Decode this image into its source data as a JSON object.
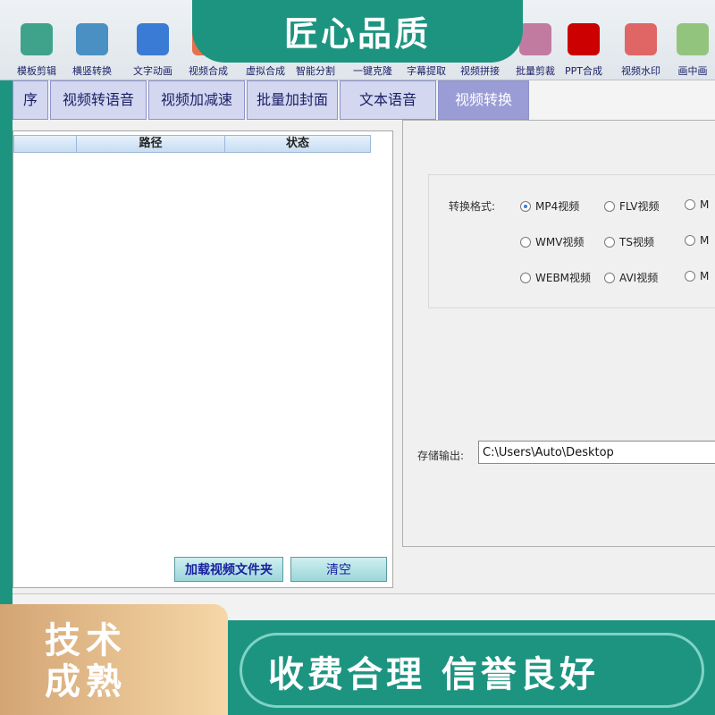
{
  "toolbar": {
    "tools": [
      {
        "label": "模板剪辑",
        "icon": "template-edit-icon",
        "color": "#3fa38c"
      },
      {
        "label": "横竖转换",
        "icon": "orientation-icon",
        "color": "#4a90c2"
      },
      {
        "label": "文字动画",
        "icon": "text-animation-icon",
        "color": "#3a7bd5"
      },
      {
        "label": "视频合成",
        "icon": "video-merge-icon",
        "color": "#e8704a"
      },
      {
        "label": "虚拟合成",
        "icon": "virtual-merge-icon",
        "color": "#6aa84f"
      },
      {
        "label": "智能分割",
        "icon": "smart-split-icon",
        "color": "#45818e"
      },
      {
        "label": "一键克隆",
        "icon": "clone-icon",
        "color": "#8e7cc3"
      },
      {
        "label": "字幕提取",
        "icon": "subtitle-extract-icon",
        "color": "#3d85c6"
      },
      {
        "label": "视频拼接",
        "icon": "video-splice-icon",
        "color": "#e69138"
      },
      {
        "label": "批量剪裁",
        "icon": "batch-crop-icon",
        "color": "#c27ba0"
      },
      {
        "label": "PPT合成",
        "icon": "ppt-merge-icon",
        "color": "#cc0000"
      },
      {
        "label": "视频水印",
        "icon": "watermark-icon",
        "color": "#e06666"
      },
      {
        "label": "画中画",
        "icon": "pip-icon",
        "color": "#93c47d"
      }
    ]
  },
  "banner": {
    "title": "匠心品质"
  },
  "tabs": [
    {
      "label": "序"
    },
    {
      "label": "视频转语音"
    },
    {
      "label": "视频加减速"
    },
    {
      "label": "批量加封面"
    },
    {
      "label": "文本语音"
    },
    {
      "label": "视频转换"
    }
  ],
  "file_list": {
    "columns": [
      "",
      "路径",
      "状态"
    ],
    "load_button": "加载视频文件夹",
    "clear_button": "清空"
  },
  "settings": {
    "format_label": "转换格式:",
    "formats": [
      {
        "label": "MP4视频",
        "checked": true
      },
      {
        "label": "FLV视频",
        "checked": false
      },
      {
        "label": "M",
        "checked": false
      },
      {
        "label": "WMV视频",
        "checked": false
      },
      {
        "label": "TS视频",
        "checked": false
      },
      {
        "label": "M",
        "checked": false
      },
      {
        "label": "WEBM视频",
        "checked": false
      },
      {
        "label": "AVI视频",
        "checked": false
      },
      {
        "label": "M",
        "checked": false
      }
    ],
    "output_label": "存储输出:",
    "output_path": "C:\\Users\\Auto\\Desktop"
  },
  "overlay": {
    "badge": "技术成熟",
    "slogan": "收费合理  信誉良好"
  }
}
